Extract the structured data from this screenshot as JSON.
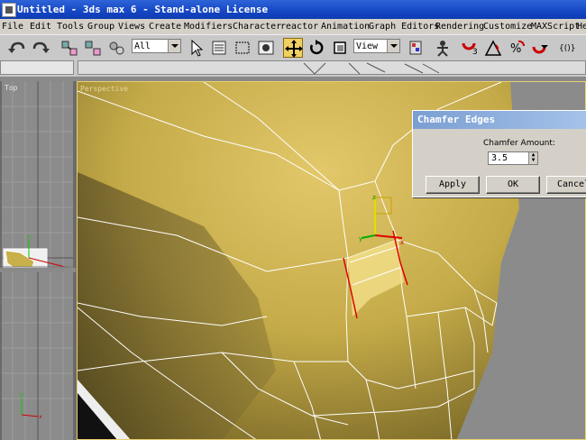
{
  "window": {
    "title": "Untitled - 3ds max 6 - Stand-alone License"
  },
  "menu": [
    "File",
    "Edit",
    "Tools",
    "Group",
    "Views",
    "Create",
    "Modifiers",
    "Character",
    "reactor",
    "Animation",
    "Graph Editors",
    "Rendering",
    "Customize",
    "MAXScript",
    "He"
  ],
  "toolbar": {
    "selection_filter": "All",
    "reference_coord": "View",
    "icons": [
      "undo-icon",
      "redo-icon",
      "select-link-icon",
      "unlink-icon",
      "bind-spacewarp-icon",
      "select-object-icon",
      "select-by-name-icon",
      "rectangular-region-icon",
      "window-crossing-icon",
      "select-move-icon",
      "select-rotate-icon",
      "select-scale-icon",
      "pivot-center-icon",
      "manipulate-icon",
      "snap-3d-icon",
      "angle-snap-icon",
      "percent-snap-icon",
      "spinner-snap-icon",
      "edit-named-selection-icon"
    ]
  },
  "viewports": {
    "top_label": "Top",
    "perspective_label": "Perspective"
  },
  "dialog": {
    "title": "Chamfer Edges",
    "amount_label": "Chamfer Amount:",
    "amount_value": "3.5",
    "apply": "Apply",
    "ok": "OK",
    "cancel": "Cancel"
  },
  "colors": {
    "title_bar": "#1546c4",
    "viewport_bg": "#8b8b8b",
    "mesh_yellow": "#c8b04a",
    "selected_edge": "#e00000",
    "active_border": "#e8d070"
  }
}
